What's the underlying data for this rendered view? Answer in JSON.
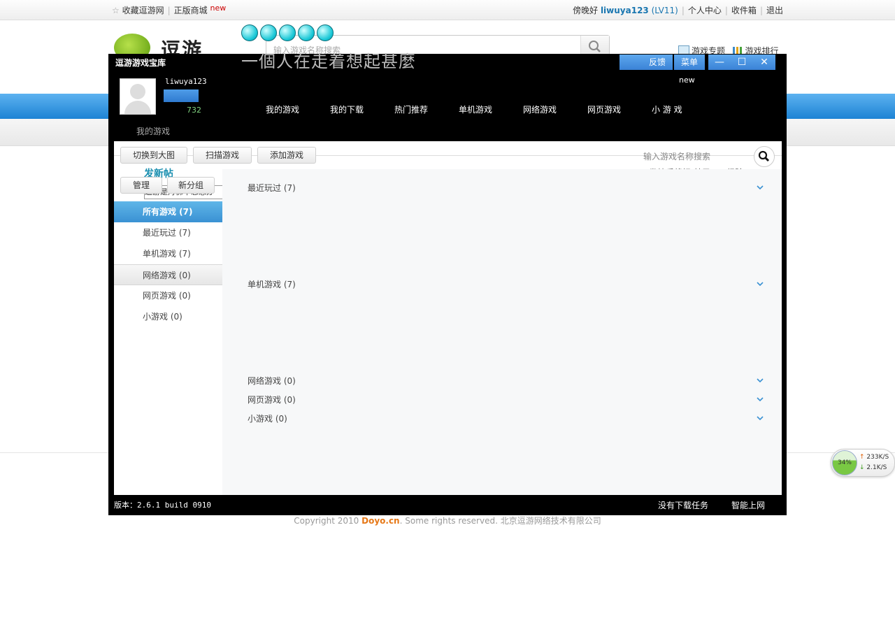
{
  "site": {
    "topbar": {
      "bookmark": "收藏逗游网",
      "shop": "正版商城",
      "shop_badge": "new",
      "greeting": "傍晚好",
      "username": "liwuya123",
      "level": "(LV11)",
      "profile": "个人中心",
      "inbox": "收件箱",
      "logout": "退出"
    },
    "logo_text": "逗游",
    "search_placeholder": "输入游戏名称搜索",
    "slogan": "一個人在走着想起甚麼",
    "links": {
      "topics": "游戏专题",
      "ranking": "游戏排行"
    },
    "copyright_pre": "Copyright 2010 ",
    "copyright_brand": "Doyo.cn",
    "copyright_post": ". Some rights reserved. 北京逗游网络技术有限公司"
  },
  "speed": {
    "percent": "34%",
    "up": "233K/S",
    "down": "2.1K/S",
    "accent_up": "#e05c00",
    "accent_down": "#3a9a1a"
  },
  "client": {
    "title": "逗游游戏宝库",
    "feedback": "反馈",
    "menu": "菜单",
    "new_tag": "new",
    "username": "liwuya123",
    "score": "732",
    "nav": [
      "我的游戏",
      "我的下载",
      "热门推荐",
      "单机游戏",
      "网络游戏",
      "网页游戏",
      "小 游 戏"
    ],
    "crumb": "我的游戏",
    "toolbar": {
      "switch": "切换到大图",
      "scan": "扫描游戏",
      "add": "添加游戏",
      "manage": "管理",
      "new_group": "新分组"
    },
    "search_placeholder": "输入游戏名称搜索",
    "ghost": {
      "heading": "发新帖",
      "box": "逗游是丹佛中恋悉办",
      "right": "发帖后将扣 基元，1 经验，5"
    },
    "sidebar": [
      "所有游戏 (7)",
      "最近玩过 (7)",
      "单机游戏 (7)",
      "网络游戏 (0)",
      "网页游戏 (0)",
      "小游戏 (0)"
    ],
    "groups": [
      "最近玩过 (7)",
      "单机游戏 (7)",
      "网络游戏 (0)",
      "网页游戏 (0)",
      "小游戏 (0)"
    ],
    "version": "版本：2.6.1 build 0910",
    "no_tasks": "没有下载任务",
    "smart_net": "智能上网",
    "accent": "#3a91d3"
  }
}
